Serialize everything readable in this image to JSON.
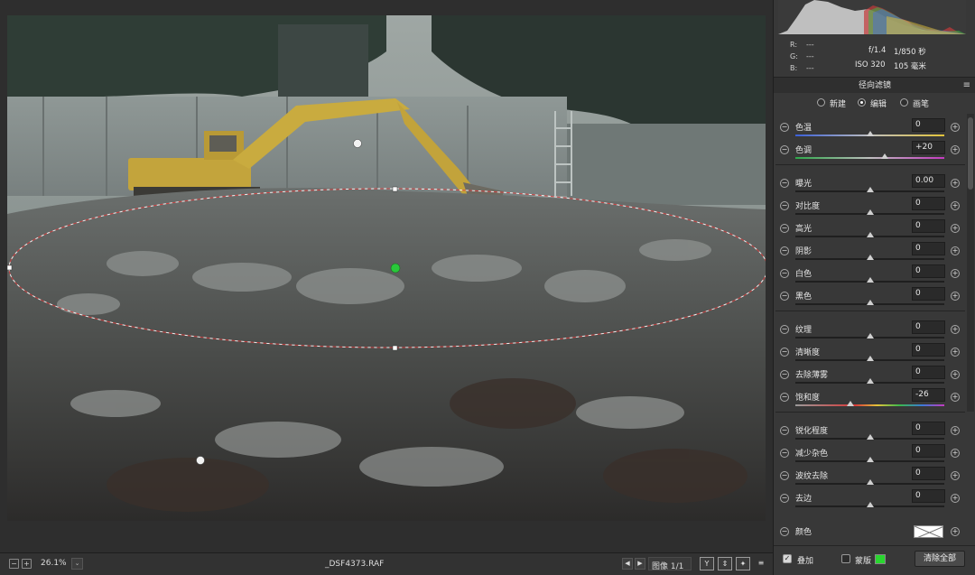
{
  "bottom_bar": {
    "zoom": "26.1%",
    "zoom_dropdown_glyph": "⌄",
    "minus_glyph": "−",
    "plus_glyph": "+",
    "filename": "_DSF4373.RAF",
    "image_count": "图像 1/1",
    "prev_glyph": "◀",
    "next_glyph": "▶",
    "view_buttons": [
      "Y",
      "⇕",
      "✦",
      "≡"
    ]
  },
  "readout": {
    "r_label": "R:",
    "r_value": "---",
    "g_label": "G:",
    "g_value": "---",
    "b_label": "B:",
    "b_value": "---",
    "aperture": "f/1.4",
    "shutter": "1/850 秒",
    "iso": "ISO 320",
    "focal_length": "105 毫米"
  },
  "panel": {
    "title": "径向滤镜",
    "menu_glyph": "≡",
    "modes": [
      {
        "label": "新建",
        "selected": false
      },
      {
        "label": "编辑",
        "selected": true
      },
      {
        "label": "画笔",
        "selected": false
      }
    ]
  },
  "sliders": [
    {
      "label": "色温",
      "value": "0",
      "pos": 0.5,
      "track": "temp"
    },
    {
      "label": "色调",
      "value": "+20",
      "pos": 0.6,
      "track": "tint"
    },
    {
      "label": "曝光",
      "value": "0.00",
      "pos": 0.5,
      "track": "plain"
    },
    {
      "label": "对比度",
      "value": "0",
      "pos": 0.5,
      "track": "plain"
    },
    {
      "label": "高光",
      "value": "0",
      "pos": 0.5,
      "track": "plain"
    },
    {
      "label": "阴影",
      "value": "0",
      "pos": 0.5,
      "track": "plain"
    },
    {
      "label": "白色",
      "value": "0",
      "pos": 0.5,
      "track": "plain"
    },
    {
      "label": "黑色",
      "value": "0",
      "pos": 0.5,
      "track": "plain"
    },
    {
      "label": "纹理",
      "value": "0",
      "pos": 0.5,
      "track": "plain"
    },
    {
      "label": "清晰度",
      "value": "0",
      "pos": 0.5,
      "track": "plain"
    },
    {
      "label": "去除薄雾",
      "value": "0",
      "pos": 0.5,
      "track": "plain"
    },
    {
      "label": "饱和度",
      "value": "-26",
      "pos": 0.37,
      "track": "sat"
    },
    {
      "label": "锐化程度",
      "value": "0",
      "pos": 0.5,
      "track": "plain"
    },
    {
      "label": "减少杂色",
      "value": "0",
      "pos": 0.5,
      "track": "plain"
    },
    {
      "label": "波纹去除",
      "value": "0",
      "pos": 0.5,
      "track": "plain"
    },
    {
      "label": "去边",
      "value": "0",
      "pos": 0.5,
      "track": "plain"
    }
  ],
  "color_row": {
    "label": "颜色",
    "swatch": "#ffffff"
  },
  "footer": {
    "overlay_label": "叠加",
    "overlay_checked": true,
    "mask_label": "蒙版",
    "mask_checked": false,
    "mask_color": "#29d62f",
    "clear_all": "清除全部"
  },
  "colors": {
    "accent_pin": "#29c83a",
    "panel_bg": "#383838"
  }
}
